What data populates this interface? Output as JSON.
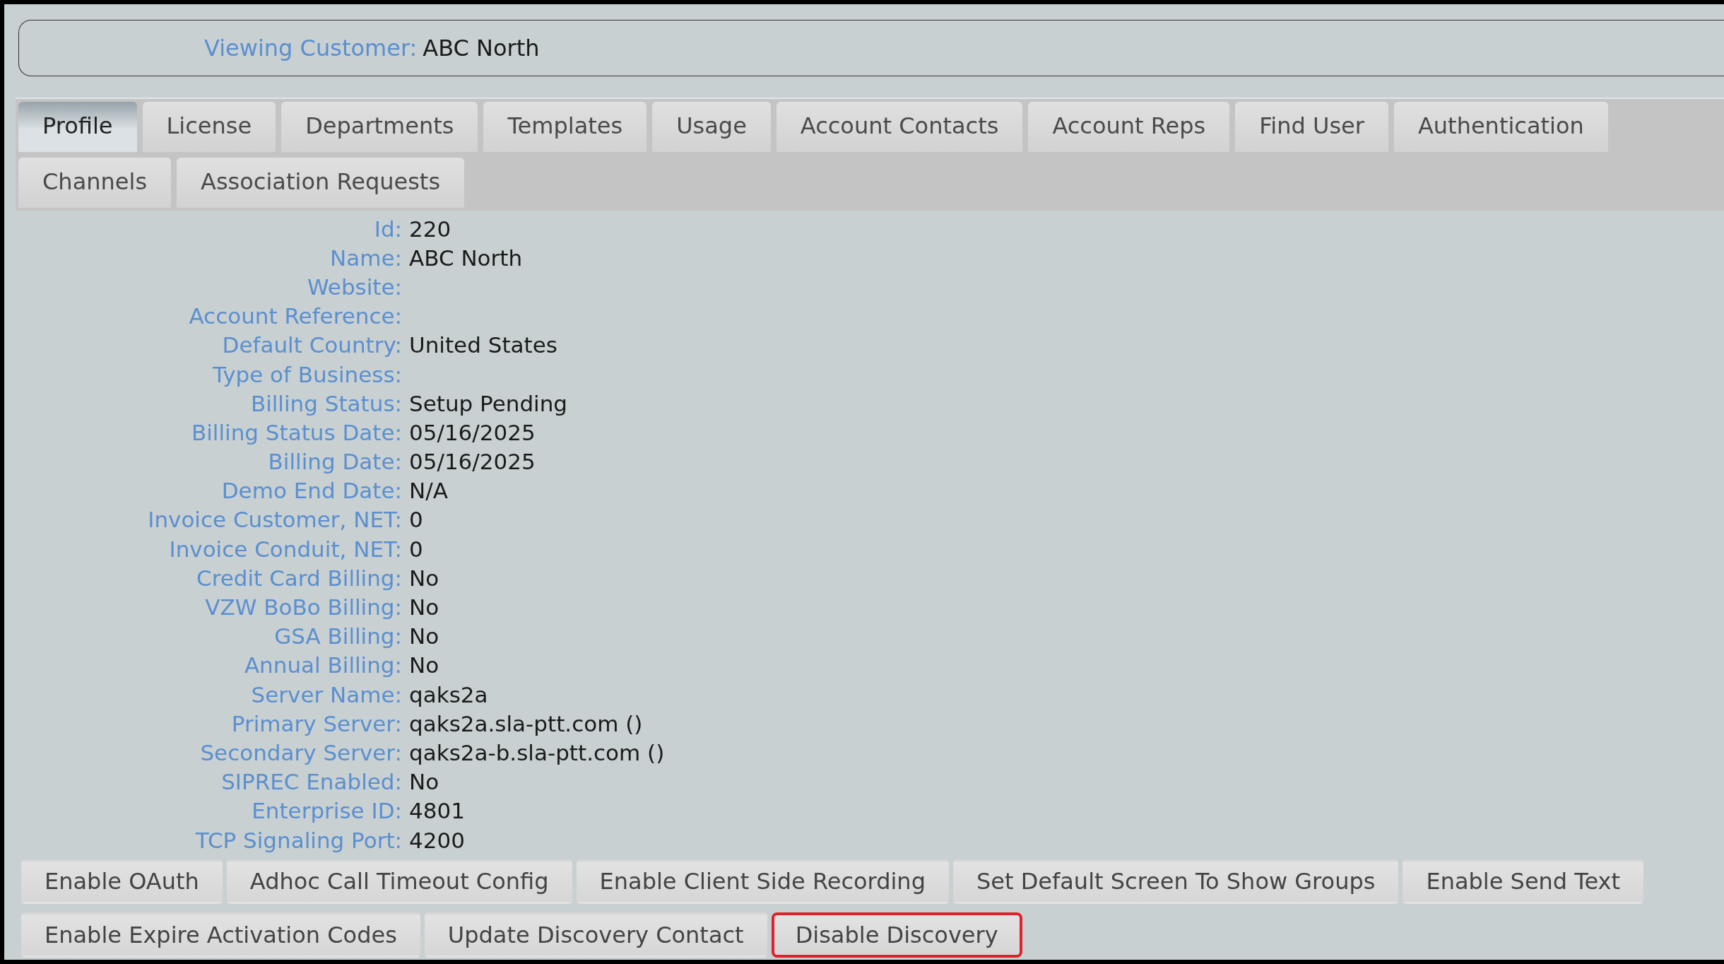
{
  "header": {
    "label": "Viewing Customer:",
    "value": "ABC North"
  },
  "tabs": [
    {
      "label": "Profile",
      "selected": true
    },
    {
      "label": "License",
      "selected": false
    },
    {
      "label": "Departments",
      "selected": false
    },
    {
      "label": "Templates",
      "selected": false
    },
    {
      "label": "Usage",
      "selected": false
    },
    {
      "label": "Account Contacts",
      "selected": false
    },
    {
      "label": "Account Reps",
      "selected": false
    },
    {
      "label": "Find User",
      "selected": false
    },
    {
      "label": "Authentication",
      "selected": false
    },
    {
      "label": "Channels",
      "selected": false
    },
    {
      "label": "Association Requests",
      "selected": false
    }
  ],
  "fields": [
    {
      "label": "Id:",
      "value": "220"
    },
    {
      "label": "Name:",
      "value": "ABC North"
    },
    {
      "label": "Website:"
    },
    {
      "label": "Account Reference:"
    },
    {
      "label": "Default Country:",
      "value": "United States"
    },
    {
      "label": "Type of Business:"
    },
    {
      "label": "Billing Status:",
      "value": "Setup Pending"
    },
    {
      "label": "Billing Status Date:",
      "value": "05/16/2025"
    },
    {
      "label": "Billing Date:",
      "value": "05/16/2025"
    },
    {
      "label": "Demo End Date:",
      "value": "N/A"
    },
    {
      "label": "Invoice Customer, NET:",
      "value": "0"
    },
    {
      "label": "Invoice Conduit, NET:",
      "value": "0"
    },
    {
      "label": "Credit Card Billing:",
      "value": "No"
    },
    {
      "label": "VZW BoBo Billing:",
      "value": "No"
    },
    {
      "label": "GSA Billing:",
      "value": "No"
    },
    {
      "label": "Annual Billing:",
      "value": "No"
    },
    {
      "label": "Server Name:",
      "value": "qaks2a"
    },
    {
      "label": "Primary Server:",
      "value": "qaks2a.sla-ptt.com ()"
    },
    {
      "label": "Secondary Server:",
      "value": "qaks2a-b.sla-ptt.com ()"
    },
    {
      "label": "SIPREC Enabled:",
      "value": "No"
    },
    {
      "label": "Enterprise ID:",
      "value": "4801"
    },
    {
      "label": "TCP Signaling Port:",
      "value": "4200"
    }
  ],
  "buttons": [
    {
      "label": "Enable OAuth",
      "highlighted": false
    },
    {
      "label": "Adhoc Call Timeout Config",
      "highlighted": false
    },
    {
      "label": "Enable Client Side Recording",
      "highlighted": false
    },
    {
      "label": "Set Default Screen To Show Groups",
      "highlighted": false
    },
    {
      "label": "Enable Send Text",
      "highlighted": false
    },
    {
      "label": "Enable Expire Activation Codes",
      "highlighted": false
    },
    {
      "label": "Update Discovery Contact",
      "highlighted": false
    },
    {
      "label": "Disable Discovery",
      "highlighted": true
    }
  ]
}
